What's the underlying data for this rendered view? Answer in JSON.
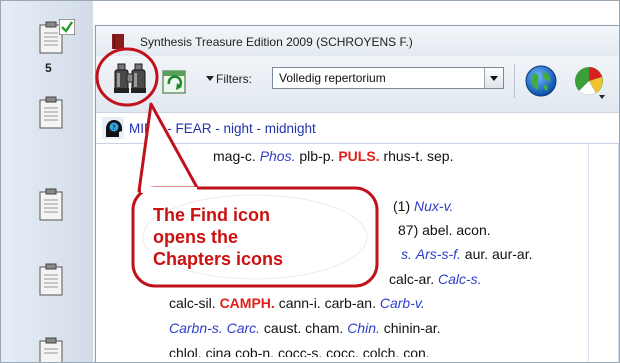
{
  "window": {
    "title": "Synthesis Treasure Edition 2009 (SCHROYENS F.)"
  },
  "sidebar": {
    "count": "5"
  },
  "toolbar": {
    "filters_label": "Filters:",
    "filter_value": "Volledig repertorium",
    "icons": [
      "find-binoculars-icon",
      "refresh-icon",
      "globe-icon",
      "pie-chart-icon"
    ]
  },
  "breadcrumb": "MIND - FEAR - night - midnight",
  "callout": {
    "lines": [
      "The Find icon",
      "opens the",
      "Chapters icons"
    ]
  },
  "remedies": {
    "line1": {
      "a": "mag-c.",
      "b": "Phos.",
      "c": "plb-p.",
      "d": "PULS.",
      "e": "rhus-t. sep."
    },
    "line2": {
      "a": "(1)",
      "b": "Nux-v."
    },
    "line3": {
      "a": "87) abel. acon."
    },
    "line4": {
      "a": "s.",
      "b": "Ars-s-f.",
      "c": "aur. aur-ar."
    },
    "line5": {
      "a": "calc-ar.",
      "b": "Calc-s."
    },
    "line6": {
      "a": "calc-sil.",
      "b": "CAMPH.",
      "c": "cann-i. carb-an.",
      "d": "Carb-v."
    },
    "line7": {
      "a": "Carbn-s.",
      "b": "Carc.",
      "c": "caust. cham.",
      "d": "Chin.",
      "e": "chinin-ar."
    },
    "line8": {
      "a": "chlol. cina cob-n. cocc-s. cocc. colch. con."
    }
  },
  "colors": {
    "callout_border": "#c0121a",
    "callout_text": "#cc1111",
    "remedy_blue": "#2e3ec8",
    "remedy_red": "#e0201a"
  }
}
